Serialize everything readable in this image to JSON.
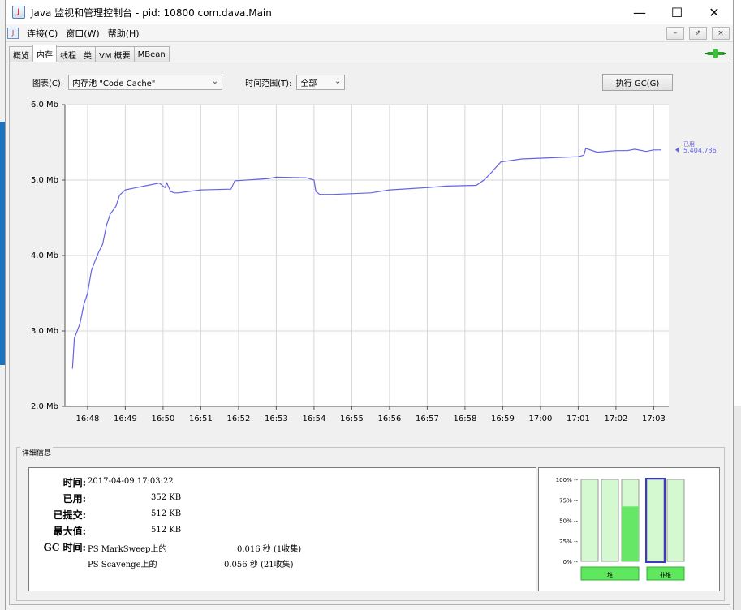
{
  "window": {
    "title": "Java 监视和管理控制台 - pid: 10800 com.dava.Main",
    "controls": {
      "minimize": "—",
      "maximize": "☐",
      "close": "✕"
    }
  },
  "menubar": {
    "items": [
      "连接(C)",
      "窗口(W)",
      "帮助(H)"
    ],
    "mdi_buttons": [
      "–",
      "⇗",
      "×"
    ]
  },
  "tabs": [
    {
      "label": "概览",
      "active": false
    },
    {
      "label": "内存",
      "active": true
    },
    {
      "label": "线程",
      "active": false
    },
    {
      "label": "类",
      "active": false
    },
    {
      "label": "VM 概要",
      "active": false
    },
    {
      "label": "MBean",
      "active": false
    }
  ],
  "controls": {
    "chart_label": "图表(C):",
    "chart_value": "内存池 \"Code Cache\"",
    "range_label": "时间范围(T):",
    "range_value": "全部",
    "gc_button": "执行 GC(G)"
  },
  "chart_data": {
    "type": "line",
    "y_ticks": [
      "6.0 Mb",
      "5.0 Mb",
      "4.0 Mb",
      "3.0 Mb",
      "2.0 Mb"
    ],
    "ylim": [
      2.0,
      6.0
    ],
    "x_ticks": [
      "16:48",
      "16:49",
      "16:50",
      "16:51",
      "16:52",
      "16:53",
      "16:54",
      "16:55",
      "16:56",
      "16:57",
      "16:58",
      "16:59",
      "17:00",
      "17:01",
      "17:02",
      "17:03"
    ],
    "grid": true,
    "series": [
      {
        "name": "已用",
        "value_label": "5,404,736",
        "color": "#6464e6",
        "x": [
          47.6,
          47.65,
          47.8,
          47.9,
          48.0,
          48.1,
          48.2,
          48.3,
          48.4,
          48.5,
          48.6,
          48.75,
          48.85,
          49.0,
          49.2,
          49.5,
          49.9,
          50.05,
          50.1,
          50.2,
          50.3,
          50.4,
          51.0,
          51.8,
          51.9,
          52.5,
          52.8,
          53.0,
          53.8,
          54.0,
          54.05,
          54.15,
          54.5,
          55.5,
          56.0,
          57.0,
          57.5,
          58.3,
          58.5,
          58.7,
          58.75,
          58.95,
          59.5,
          60.5,
          61.0,
          61.15,
          61.2,
          61.5,
          62.0,
          62.3,
          62.5,
          62.8,
          63.0,
          63.2
        ],
        "y": [
          2.5,
          2.9,
          3.1,
          3.35,
          3.5,
          3.8,
          3.93,
          4.05,
          4.15,
          4.4,
          4.55,
          4.65,
          4.8,
          4.87,
          4.89,
          4.92,
          4.96,
          4.9,
          4.96,
          4.85,
          4.83,
          4.83,
          4.87,
          4.88,
          4.99,
          5.01,
          5.02,
          5.04,
          5.03,
          5.0,
          4.85,
          4.81,
          4.81,
          4.83,
          4.87,
          4.9,
          4.92,
          4.93,
          5.0,
          5.1,
          5.13,
          5.24,
          5.28,
          5.3,
          5.31,
          5.33,
          5.42,
          5.37,
          5.39,
          5.39,
          5.41,
          5.38,
          5.4,
          5.4
        ]
      }
    ]
  },
  "details": {
    "title": "详细信息",
    "time_label": "时间:",
    "time_value": "2017-04-09 17:03:22",
    "used_label": "已用:",
    "used_value": "352 KB",
    "committed_label": "已提交:",
    "committed_value": "512 KB",
    "max_label": "最大值:",
    "max_value": "512 KB",
    "gc_label": "GC 时间:",
    "gc_rows": [
      {
        "name": "PS MarkSweep上的",
        "value": "0.016  秒 (1收集)"
      },
      {
        "name": "PS Scavenge上的",
        "value": "0.056  秒 (21收集)"
      }
    ]
  },
  "pool_bars": {
    "y_ticks": [
      "100% --",
      "75% --",
      "50% --",
      "25% --",
      "0% --"
    ],
    "groups": [
      {
        "label": "堆",
        "fills": [
          0,
          0,
          0.67
        ]
      },
      {
        "label": "非堆",
        "fills": [
          0,
          0
        ],
        "selected_index": 0
      }
    ]
  },
  "colors": {
    "line": "#6464e6",
    "bar_fill": "#66e866",
    "bar_empty": "#d4f8d0",
    "bar_label_bg": "#5ee85e",
    "selected_border": "#3a3ac8"
  }
}
